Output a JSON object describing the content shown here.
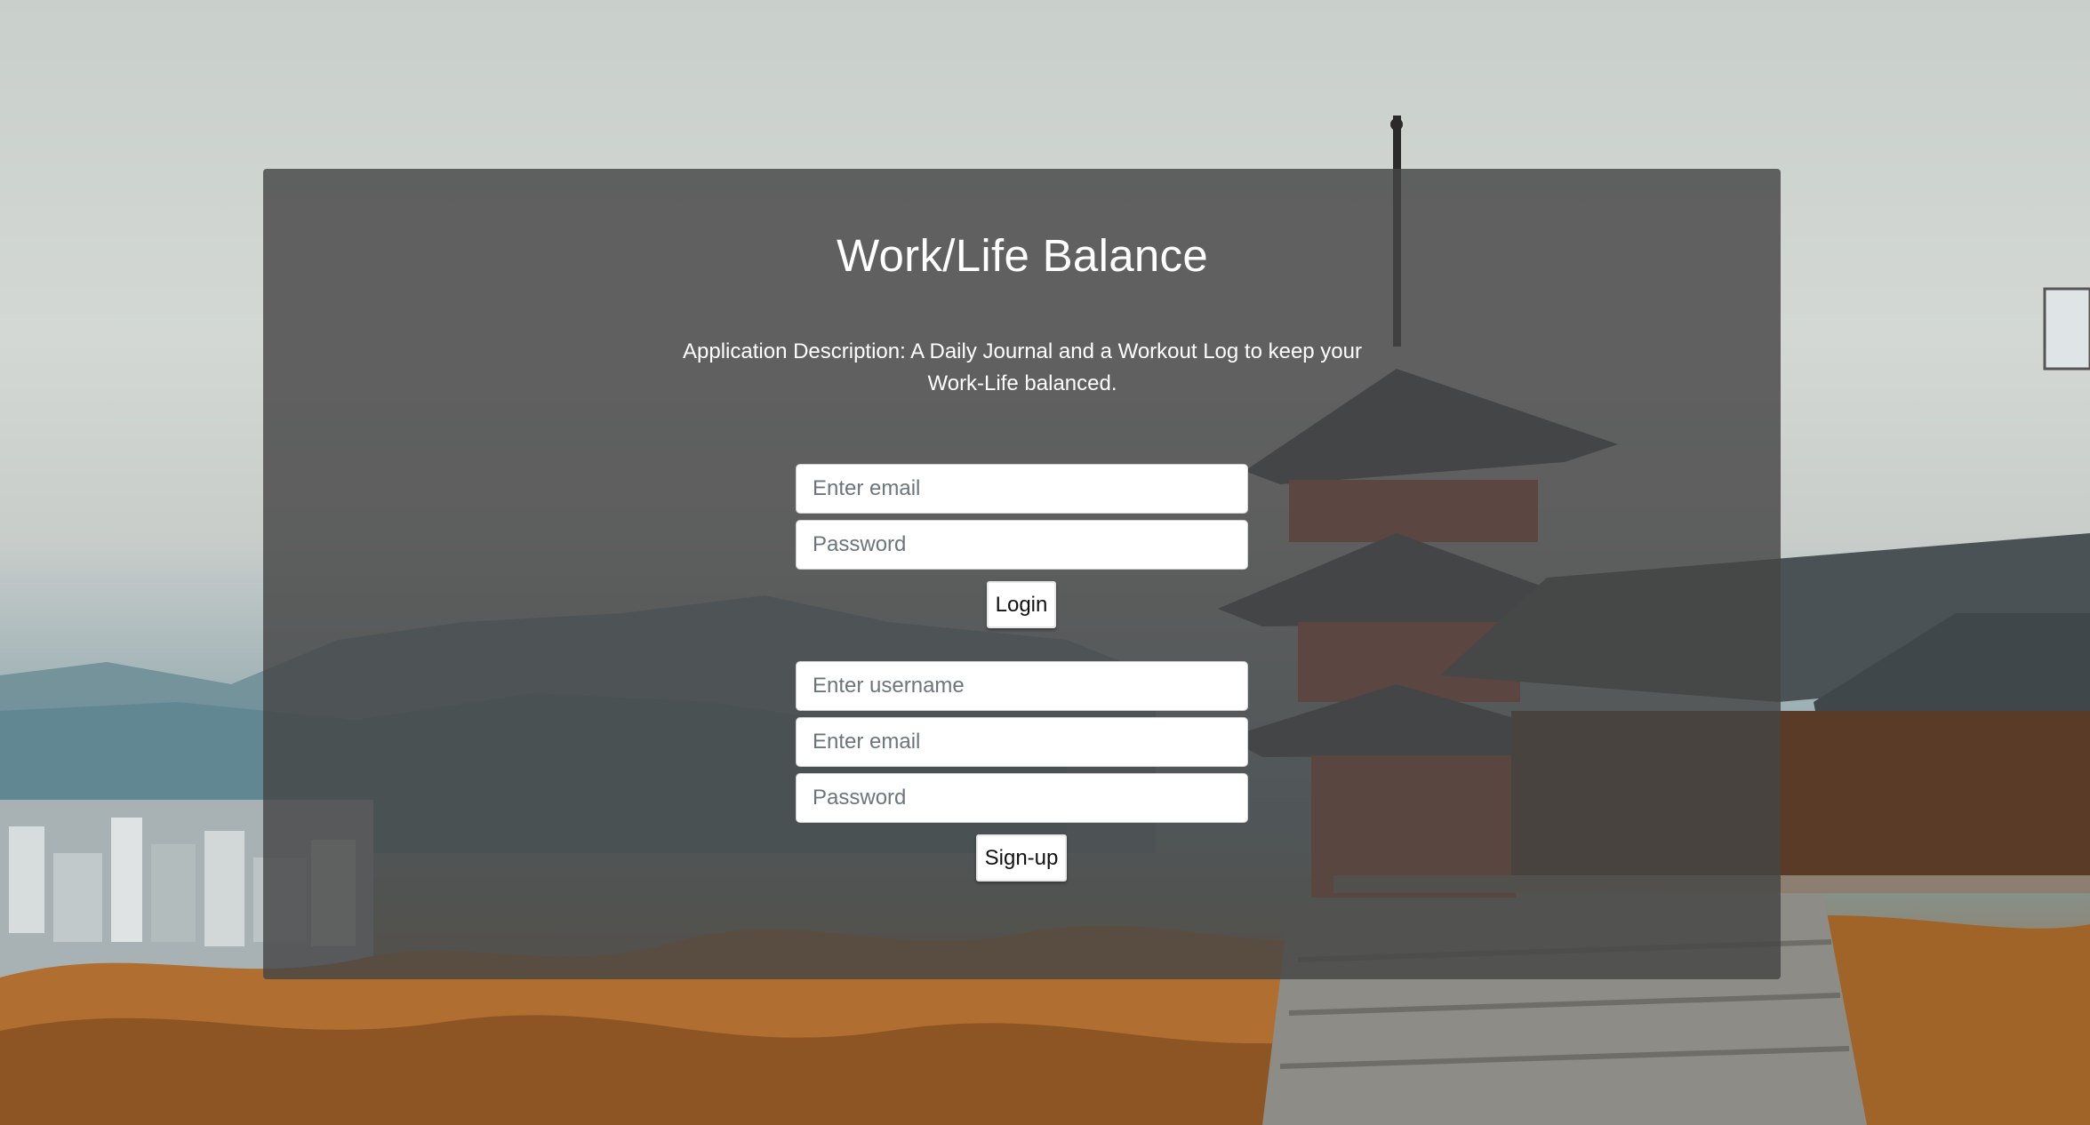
{
  "app": {
    "title": "Work/Life Balance",
    "description": "Application Description: A Daily Journal and a Workout Log to keep your Work-Life balanced."
  },
  "login": {
    "email_placeholder": "Enter email",
    "password_placeholder": "Password",
    "submit_label": "Login"
  },
  "signup": {
    "username_placeholder": "Enter username",
    "email_placeholder": "Enter email",
    "password_placeholder": "Password",
    "submit_label": "Sign-up"
  },
  "colors": {
    "panel": "#464646",
    "text": "#ffffff",
    "field_bg": "#ffffff",
    "placeholder": "#6c757d"
  }
}
